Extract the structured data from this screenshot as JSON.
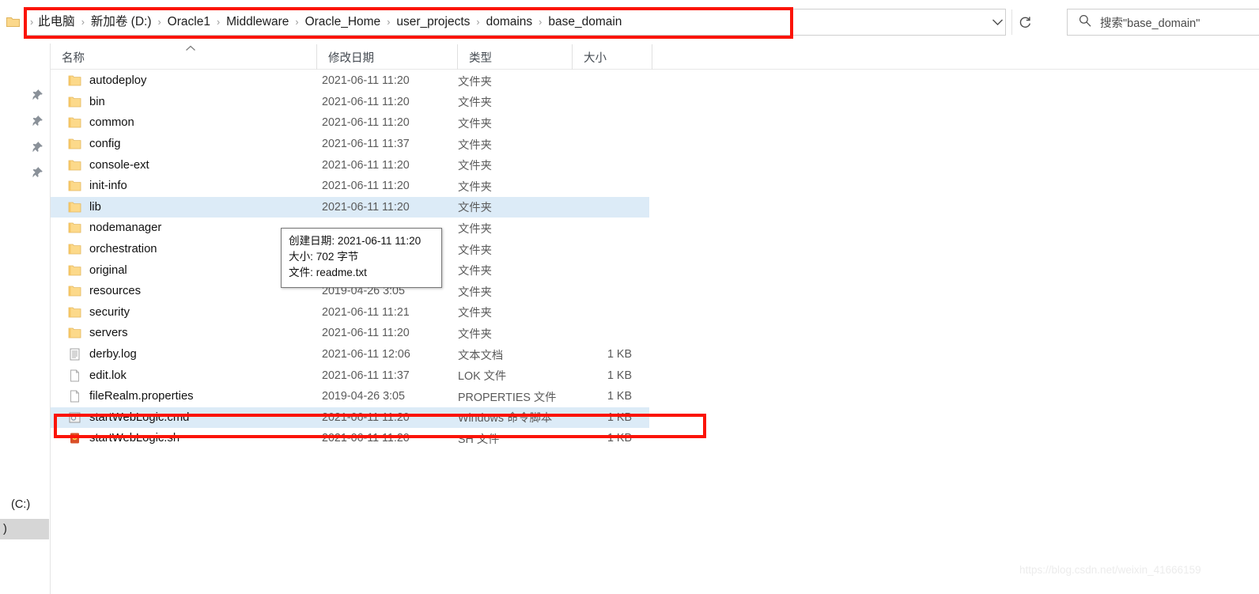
{
  "address_bar": {
    "folder_icon": "folder-icon",
    "leading_chevron": "›",
    "separator": "›",
    "breadcrumbs": [
      "此电脑",
      "新加卷 (D:)",
      "Oracle1",
      "Middleware",
      "Oracle_Home",
      "user_projects",
      "domains",
      "base_domain"
    ],
    "dropdown_icon": "chevron-down-icon",
    "refresh_icon": "refresh-icon"
  },
  "search": {
    "icon": "search-icon",
    "placeholder": "搜索\"base_domain\""
  },
  "nav_pane": {
    "pins": [
      "pin-icon",
      "pin-icon",
      "pin-icon",
      "pin-icon"
    ],
    "drives": [
      {
        "label": "(C:)",
        "selected": false
      },
      {
        "label": ")",
        "selected": true
      }
    ]
  },
  "columns": {
    "name": "名称",
    "date_modified": "修改日期",
    "type": "类型",
    "size": "大小",
    "sort_icon": "chevron-up-icon"
  },
  "files": [
    {
      "name": "autodeploy",
      "icon": "folder-icon",
      "date": "2021-06-11 11:20",
      "type": "文件夹",
      "size": "",
      "selected": false
    },
    {
      "name": "bin",
      "icon": "folder-icon",
      "date": "2021-06-11 11:20",
      "type": "文件夹",
      "size": "",
      "selected": false
    },
    {
      "name": "common",
      "icon": "folder-icon",
      "date": "2021-06-11 11:20",
      "type": "文件夹",
      "size": "",
      "selected": false
    },
    {
      "name": "config",
      "icon": "folder-icon",
      "date": "2021-06-11 11:37",
      "type": "文件夹",
      "size": "",
      "selected": false
    },
    {
      "name": "console-ext",
      "icon": "folder-icon",
      "date": "2021-06-11 11:20",
      "type": "文件夹",
      "size": "",
      "selected": false
    },
    {
      "name": "init-info",
      "icon": "folder-icon",
      "date": "2021-06-11 11:20",
      "type": "文件夹",
      "size": "",
      "selected": false
    },
    {
      "name": "lib",
      "icon": "folder-icon",
      "date": "2021-06-11 11:20",
      "type": "文件夹",
      "size": "",
      "selected": true
    },
    {
      "name": "nodemanager",
      "icon": "folder-icon",
      "date": "",
      "type": "文件夹",
      "size": "",
      "selected": false
    },
    {
      "name": "orchestration",
      "icon": "folder-icon",
      "date": "",
      "type": "文件夹",
      "size": "",
      "selected": false
    },
    {
      "name": "original",
      "icon": "folder-icon",
      "date": "",
      "type": "文件夹",
      "size": "",
      "selected": false
    },
    {
      "name": "resources",
      "icon": "folder-icon",
      "date": "2019-04-26 3:05",
      "type": "文件夹",
      "size": "",
      "selected": false
    },
    {
      "name": "security",
      "icon": "folder-icon",
      "date": "2021-06-11 11:21",
      "type": "文件夹",
      "size": "",
      "selected": false
    },
    {
      "name": "servers",
      "icon": "folder-icon",
      "date": "2021-06-11 11:20",
      "type": "文件夹",
      "size": "",
      "selected": false
    },
    {
      "name": "derby.log",
      "icon": "text-file-icon",
      "date": "2021-06-11 12:06",
      "type": "文本文档",
      "size": "1 KB",
      "selected": false
    },
    {
      "name": "edit.lok",
      "icon": "blank-file-icon",
      "date": "2021-06-11 11:37",
      "type": "LOK 文件",
      "size": "1 KB",
      "selected": false
    },
    {
      "name": "fileRealm.properties",
      "icon": "blank-file-icon",
      "date": "2019-04-26 3:05",
      "type": "PROPERTIES 文件",
      "size": "1 KB",
      "selected": false
    },
    {
      "name": "startWebLogic.cmd",
      "icon": "cmd-script-icon",
      "date": "2021-06-11 11:20",
      "type": "Windows 命令脚本",
      "size": "1 KB",
      "selected": true
    },
    {
      "name": "startWebLogic.sh",
      "icon": "sh-file-icon",
      "date": "2021-06-11 11:20",
      "type": "SH 文件",
      "size": "1 KB",
      "selected": false
    }
  ],
  "tooltip": {
    "created_label": "创建日期: 2021-06-11 11:20",
    "size_label": "大小: 702 字节",
    "file_label": "文件: readme.txt"
  },
  "annotations": {
    "highlight_color": "#fb1407"
  },
  "watermark": "https://blog.csdn.net/weixin_41666159"
}
